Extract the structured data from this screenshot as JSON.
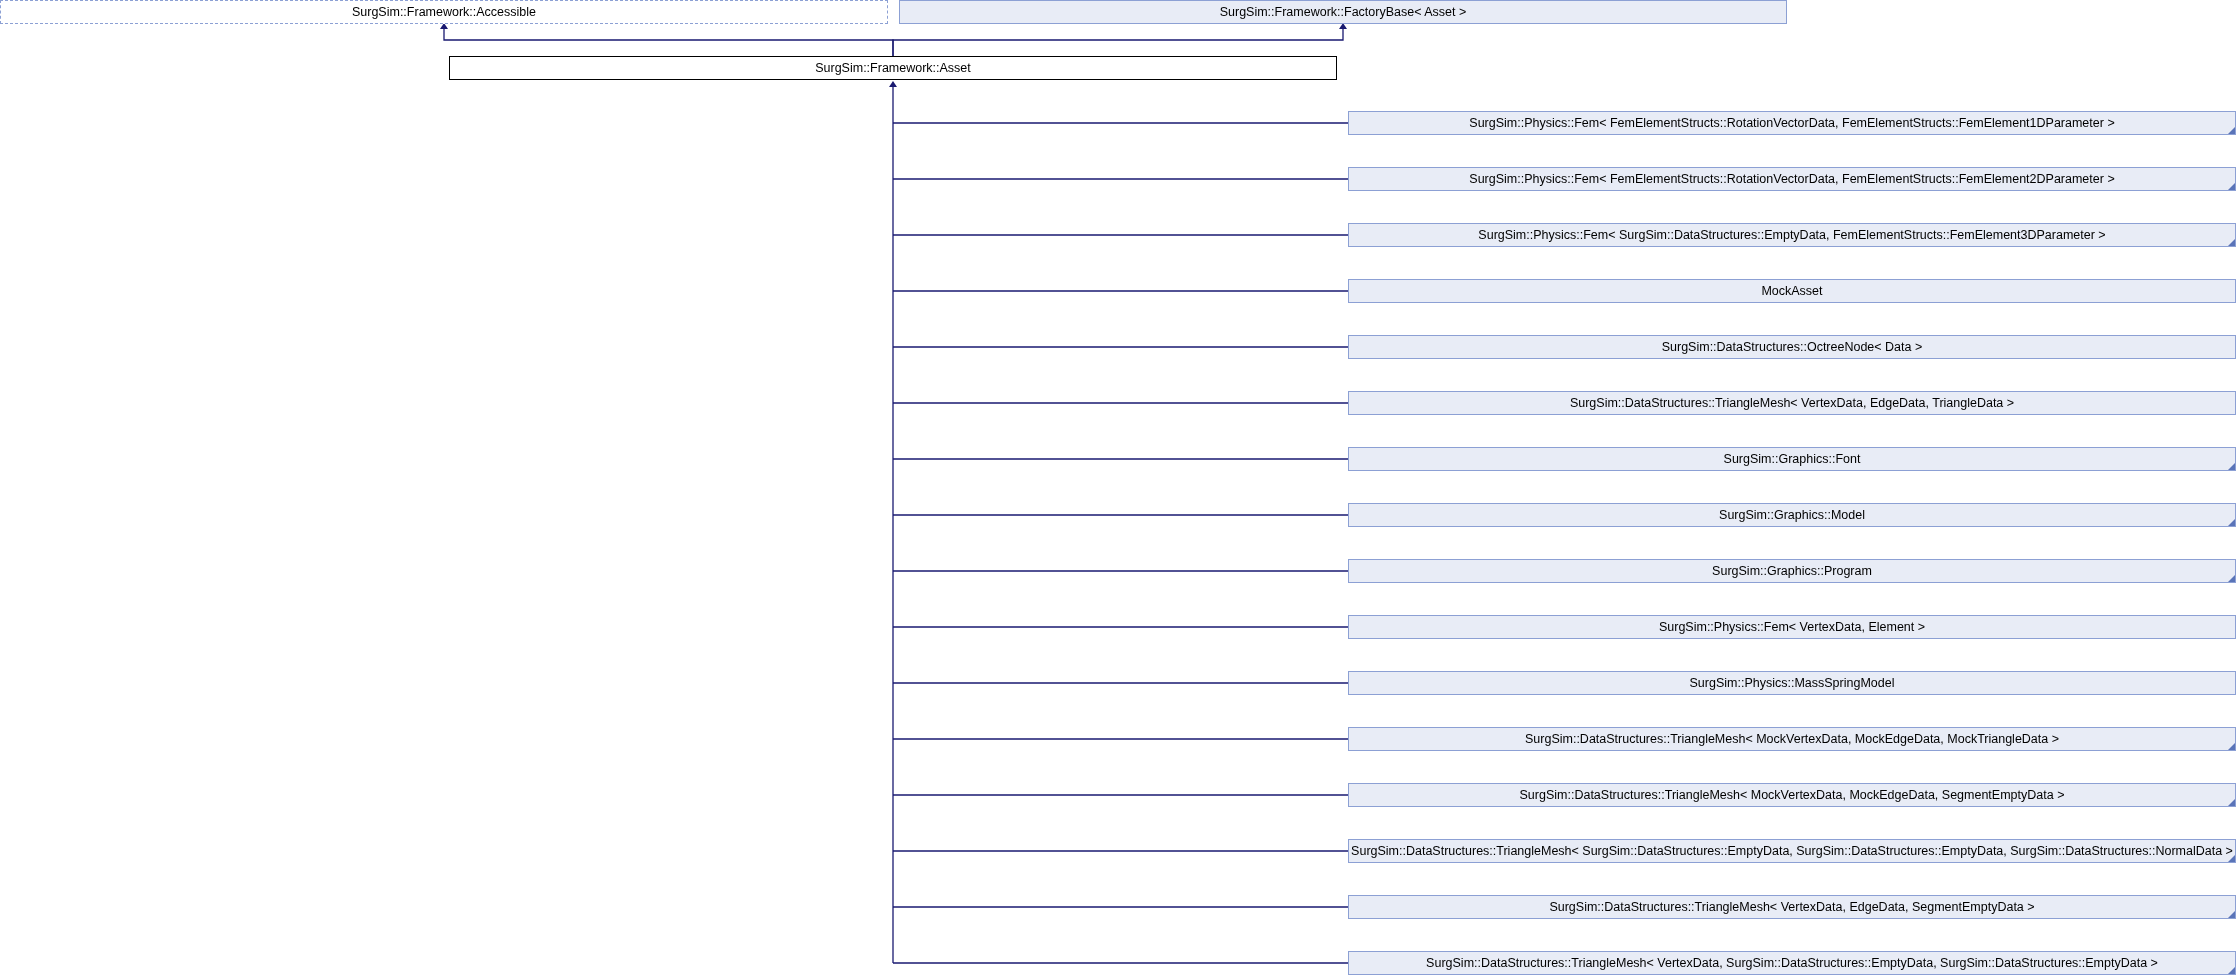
{
  "base_classes": [
    {
      "label": "SurgSim::Framework::Accessible",
      "kind": "undocumented"
    },
    {
      "label": "SurgSim::Framework::FactoryBase< Asset >",
      "kind": "documented"
    }
  ],
  "current_class": {
    "label": "SurgSim::Framework::Asset"
  },
  "derived_classes": [
    {
      "label": "SurgSim::Physics::Fem< FemElementStructs::RotationVectorData, FemElementStructs::FemElement1DParameter >",
      "has_more": true
    },
    {
      "label": "SurgSim::Physics::Fem< FemElementStructs::RotationVectorData, FemElementStructs::FemElement2DParameter >",
      "has_more": true
    },
    {
      "label": "SurgSim::Physics::Fem< SurgSim::DataStructures::EmptyData, FemElementStructs::FemElement3DParameter >",
      "has_more": true
    },
    {
      "label": "MockAsset",
      "has_more": false
    },
    {
      "label": "SurgSim::DataStructures::OctreeNode< Data >",
      "has_more": false
    },
    {
      "label": "SurgSim::DataStructures::TriangleMesh< VertexData, EdgeData, TriangleData >",
      "has_more": false
    },
    {
      "label": "SurgSim::Graphics::Font",
      "has_more": true
    },
    {
      "label": "SurgSim::Graphics::Model",
      "has_more": true
    },
    {
      "label": "SurgSim::Graphics::Program",
      "has_more": true
    },
    {
      "label": "SurgSim::Physics::Fem< VertexData, Element >",
      "has_more": false
    },
    {
      "label": "SurgSim::Physics::MassSpringModel",
      "has_more": false
    },
    {
      "label": "SurgSim::DataStructures::TriangleMesh< MockVertexData, MockEdgeData, MockTriangleData >",
      "has_more": true
    },
    {
      "label": "SurgSim::DataStructures::TriangleMesh< MockVertexData, MockEdgeData, SegmentEmptyData >",
      "has_more": true
    },
    {
      "label": "SurgSim::DataStructures::TriangleMesh< SurgSim::DataStructures::EmptyData, SurgSim::DataStructures::EmptyData, SurgSim::DataStructures::NormalData >",
      "has_more": true
    },
    {
      "label": "SurgSim::DataStructures::TriangleMesh< VertexData, EdgeData, SegmentEmptyData >",
      "has_more": true
    },
    {
      "label": "SurgSim::DataStructures::TriangleMesh< VertexData, SurgSim::DataStructures::EmptyData, SurgSim::DataStructures::EmptyData >",
      "has_more": true
    }
  ]
}
